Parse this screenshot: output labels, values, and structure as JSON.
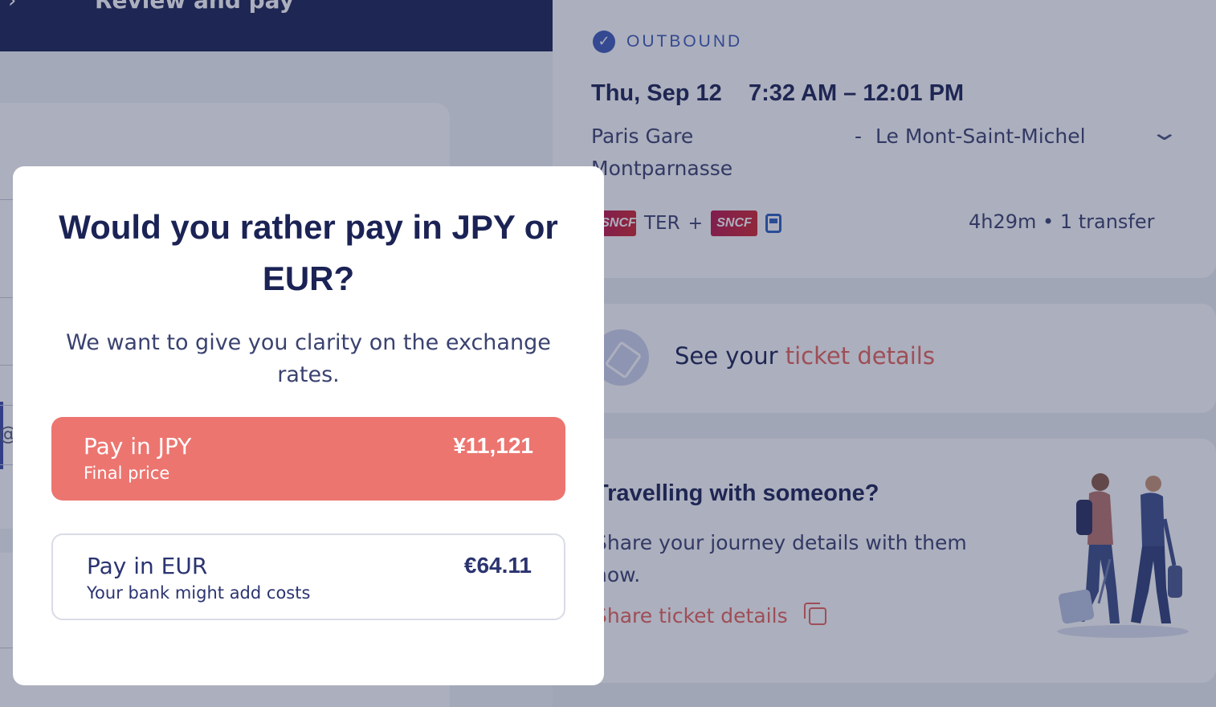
{
  "header": {
    "step_label": "Review and pay"
  },
  "outbound": {
    "label": "OUTBOUND",
    "date": "Thu, Sep 12",
    "time": "7:32 AM – 12:01 PM",
    "from": "Paris Gare Montparnasse",
    "dash": "-",
    "to": "Le Mont-Saint-Michel",
    "operator_1": "SNCF",
    "train_type": "TER",
    "plus": "+",
    "operator_2": "SNCF",
    "duration": "4h29m • 1 transfer"
  },
  "ticket": {
    "prefix": "See your ",
    "link": "ticket details"
  },
  "share": {
    "title": "Travelling with someone?",
    "body": "Share your journey details with them now.",
    "link": "Share ticket details"
  },
  "left": {
    "field_symbol": "@"
  },
  "modal": {
    "title": "Would you rather pay in JPY or EUR?",
    "subtitle": "We want to give you clarity on the exchange rates.",
    "options": [
      {
        "name": "Pay in JPY",
        "note": "Final price",
        "price": "¥11,121"
      },
      {
        "name": "Pay in EUR",
        "note": "Your bank might add costs",
        "price": "€64.11"
      }
    ]
  },
  "colors": {
    "navy": "#1b2355",
    "accent": "#ec7570",
    "link": "#e8635b",
    "blue": "#3e5bb8"
  },
  "icons": [
    "chevron-left-icon",
    "check-circle-icon",
    "chevron-down-icon",
    "bus-icon",
    "ticket-icon",
    "copy-icon"
  ]
}
